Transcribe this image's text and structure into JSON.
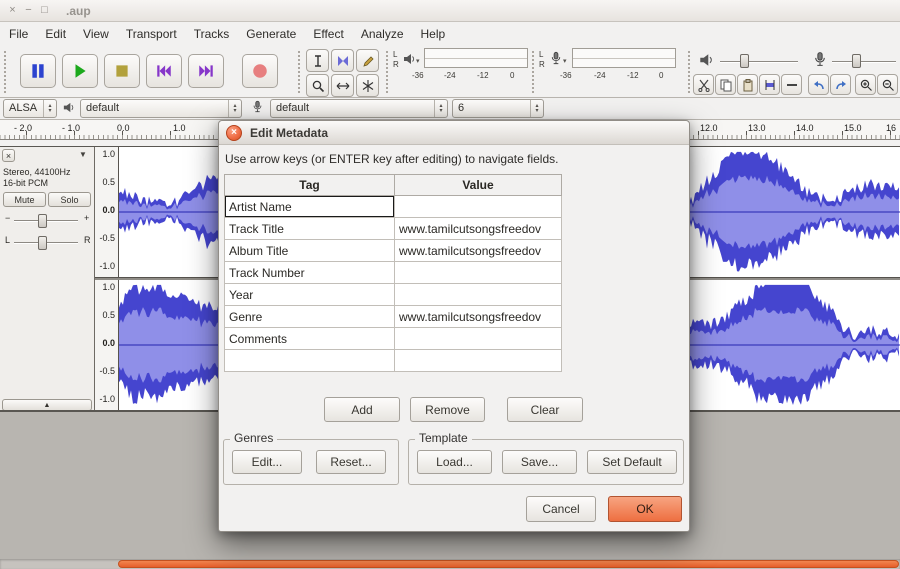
{
  "window": {
    "title": ".aup"
  },
  "icons": {
    "close_window": "×",
    "minimize_window": "−",
    "maximize_window": "□",
    "dropdown": "▾",
    "spin_up": "▴",
    "spin_down": "▾",
    "track_menu": "▼",
    "track_close": "×",
    "collapse": "▲",
    "dialog_close": "×"
  },
  "menubar": {
    "items": [
      "File",
      "Edit",
      "View",
      "Transport",
      "Tracks",
      "Generate",
      "Effect",
      "Analyze",
      "Help"
    ]
  },
  "meters": {
    "channels": [
      "L",
      "R"
    ],
    "scale": [
      "-36",
      "-24",
      "-12",
      "0"
    ]
  },
  "device_toolbar": {
    "host": "ALSA",
    "playback_device": "default",
    "recording_device": "default",
    "recording_channels": "6"
  },
  "timeline": {
    "left": [
      "- 2.0",
      "- 1.0",
      "0.0",
      "1.0"
    ],
    "right": [
      "12.0",
      "13.0",
      "14.0",
      "15.0",
      "16"
    ]
  },
  "track_panel": {
    "name_line1": "Stereo, 44100Hz",
    "name_line2": "16-bit PCM",
    "mute": "Mute",
    "solo": "Solo",
    "gain_min": "−",
    "gain_max": "+",
    "pan_left": "L",
    "pan_right": "R"
  },
  "vertical_scale": [
    "1.0",
    "0.5",
    "0.0",
    "-0.5",
    "-1.0"
  ],
  "dialog": {
    "title": "Edit Metadata",
    "instruction": "Use arrow keys (or ENTER key after editing) to navigate fields.",
    "table": {
      "headers": [
        "Tag",
        "Value"
      ],
      "rows": [
        {
          "tag": "Artist Name",
          "value": ""
        },
        {
          "tag": "Track Title",
          "value": "www.tamilcutsongsfreedov"
        },
        {
          "tag": "Album Title",
          "value": "www.tamilcutsongsfreedov"
        },
        {
          "tag": "Track Number",
          "value": ""
        },
        {
          "tag": "Year",
          "value": ""
        },
        {
          "tag": "Genre",
          "value": "www.tamilcutsongsfreedov"
        },
        {
          "tag": "Comments",
          "value": ""
        },
        {
          "tag": "",
          "value": ""
        }
      ]
    },
    "buttons": {
      "add": "Add",
      "remove": "Remove",
      "clear": "Clear"
    },
    "genres": {
      "label": "Genres",
      "edit": "Edit...",
      "reset": "Reset..."
    },
    "template": {
      "label": "Template",
      "load": "Load...",
      "save": "Save...",
      "set_default": "Set Default"
    },
    "cancel": "Cancel",
    "ok": "OK"
  },
  "colors": {
    "accent_orange": "#ee6f41",
    "waveform": "#4545cf",
    "waveform_core": "#8f8fe8",
    "waveform_centerline": "#2626b0",
    "scrollbar_thumb": "#ee7143",
    "record_red": "#e77f7f",
    "play_green": "#1ca91c"
  }
}
